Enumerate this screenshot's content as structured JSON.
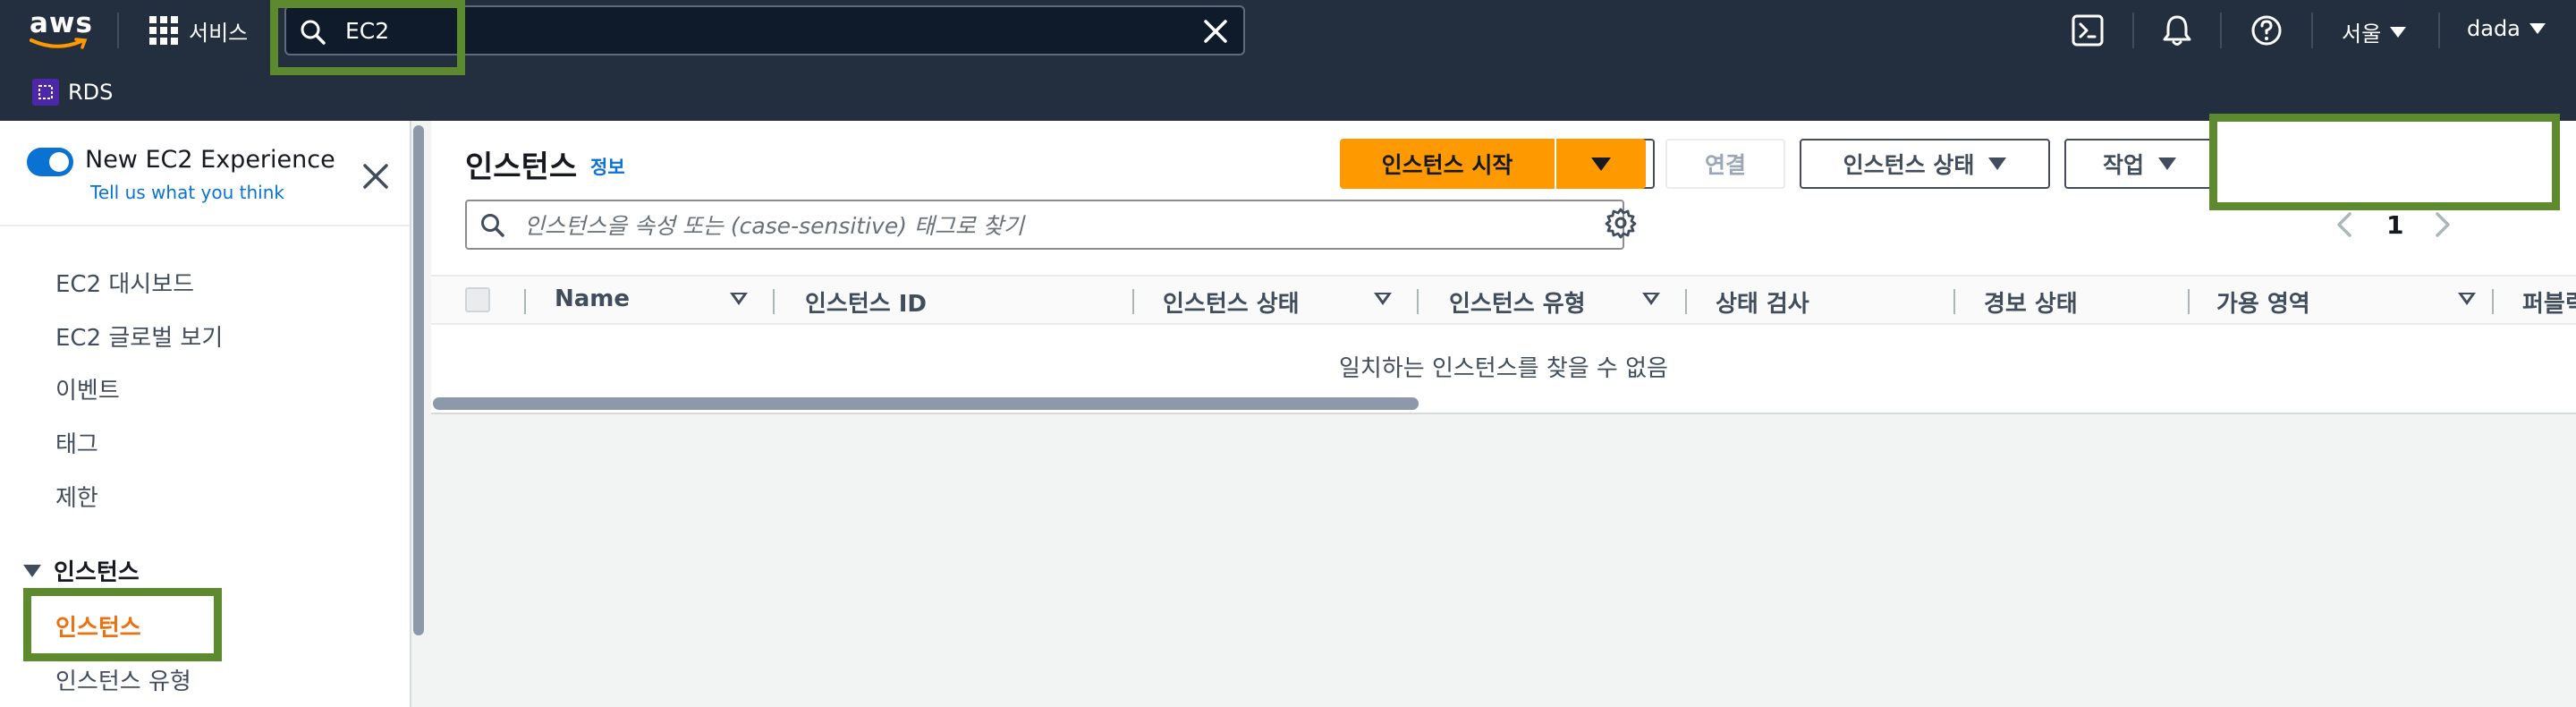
{
  "topnav": {
    "logo_text": "aws",
    "services_label": "서비스",
    "search_value": "EC2",
    "region_label": "서울",
    "user_label": "dada",
    "favorites": [
      {
        "label": "RDS"
      }
    ],
    "colors": {
      "bg": "#232f3e",
      "highlight": "#5d8a2e"
    }
  },
  "sidebar": {
    "experience_title": "New EC2 Experience",
    "experience_link": "Tell us what you think",
    "items": [
      {
        "label": "EC2 대시보드"
      },
      {
        "label": "EC2 글로벌 보기"
      },
      {
        "label": "이벤트"
      },
      {
        "label": "태그"
      },
      {
        "label": "제한"
      }
    ],
    "section_label": "인스턴스",
    "section_items": [
      {
        "label": "인스턴스",
        "active": true
      },
      {
        "label": "인스턴스 유형"
      }
    ]
  },
  "main": {
    "title": "인스턴스",
    "info_label": "정보",
    "buttons": {
      "connect": "연결",
      "instance_state": "인스턴스 상태",
      "actions": "작업",
      "launch": "인스턴스 시작"
    },
    "filter_placeholder": "인스턴스을 속성 또는 (case-sensitive) 태그로 찾기",
    "page_number": "1",
    "columns": [
      "Name",
      "인스턴스 ID",
      "인스턴스 상태",
      "인스턴스 유형",
      "상태 검사",
      "경보 상태",
      "가용 영역",
      "퍼블릭"
    ],
    "empty_message": "일치하는 인스턴스를 찾을 수 없음",
    "colors": {
      "primary": "#ff9900",
      "link": "#0972d3",
      "active": "#ec7211"
    }
  }
}
